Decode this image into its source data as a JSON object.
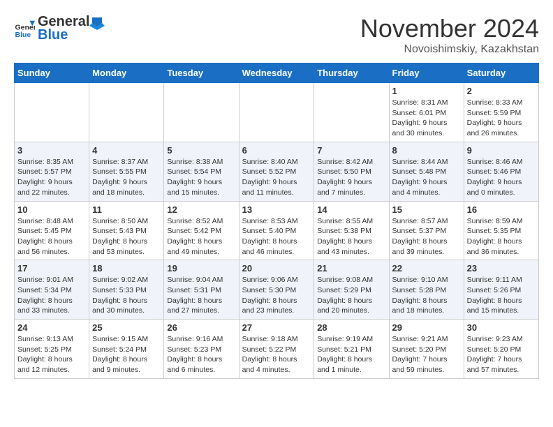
{
  "header": {
    "logo_general": "General",
    "logo_blue": "Blue",
    "month_title": "November 2024",
    "location": "Novoishimskiy, Kazakhstan"
  },
  "days_of_week": [
    "Sunday",
    "Monday",
    "Tuesday",
    "Wednesday",
    "Thursday",
    "Friday",
    "Saturday"
  ],
  "weeks": [
    [
      {
        "day": "",
        "info": ""
      },
      {
        "day": "",
        "info": ""
      },
      {
        "day": "",
        "info": ""
      },
      {
        "day": "",
        "info": ""
      },
      {
        "day": "",
        "info": ""
      },
      {
        "day": "1",
        "info": "Sunrise: 8:31 AM\nSunset: 6:01 PM\nDaylight: 9 hours and 30 minutes."
      },
      {
        "day": "2",
        "info": "Sunrise: 8:33 AM\nSunset: 5:59 PM\nDaylight: 9 hours and 26 minutes."
      }
    ],
    [
      {
        "day": "3",
        "info": "Sunrise: 8:35 AM\nSunset: 5:57 PM\nDaylight: 9 hours and 22 minutes."
      },
      {
        "day": "4",
        "info": "Sunrise: 8:37 AM\nSunset: 5:55 PM\nDaylight: 9 hours and 18 minutes."
      },
      {
        "day": "5",
        "info": "Sunrise: 8:38 AM\nSunset: 5:54 PM\nDaylight: 9 hours and 15 minutes."
      },
      {
        "day": "6",
        "info": "Sunrise: 8:40 AM\nSunset: 5:52 PM\nDaylight: 9 hours and 11 minutes."
      },
      {
        "day": "7",
        "info": "Sunrise: 8:42 AM\nSunset: 5:50 PM\nDaylight: 9 hours and 7 minutes."
      },
      {
        "day": "8",
        "info": "Sunrise: 8:44 AM\nSunset: 5:48 PM\nDaylight: 9 hours and 4 minutes."
      },
      {
        "day": "9",
        "info": "Sunrise: 8:46 AM\nSunset: 5:46 PM\nDaylight: 9 hours and 0 minutes."
      }
    ],
    [
      {
        "day": "10",
        "info": "Sunrise: 8:48 AM\nSunset: 5:45 PM\nDaylight: 8 hours and 56 minutes."
      },
      {
        "day": "11",
        "info": "Sunrise: 8:50 AM\nSunset: 5:43 PM\nDaylight: 8 hours and 53 minutes."
      },
      {
        "day": "12",
        "info": "Sunrise: 8:52 AM\nSunset: 5:42 PM\nDaylight: 8 hours and 49 minutes."
      },
      {
        "day": "13",
        "info": "Sunrise: 8:53 AM\nSunset: 5:40 PM\nDaylight: 8 hours and 46 minutes."
      },
      {
        "day": "14",
        "info": "Sunrise: 8:55 AM\nSunset: 5:38 PM\nDaylight: 8 hours and 43 minutes."
      },
      {
        "day": "15",
        "info": "Sunrise: 8:57 AM\nSunset: 5:37 PM\nDaylight: 8 hours and 39 minutes."
      },
      {
        "day": "16",
        "info": "Sunrise: 8:59 AM\nSunset: 5:35 PM\nDaylight: 8 hours and 36 minutes."
      }
    ],
    [
      {
        "day": "17",
        "info": "Sunrise: 9:01 AM\nSunset: 5:34 PM\nDaylight: 8 hours and 33 minutes."
      },
      {
        "day": "18",
        "info": "Sunrise: 9:02 AM\nSunset: 5:33 PM\nDaylight: 8 hours and 30 minutes."
      },
      {
        "day": "19",
        "info": "Sunrise: 9:04 AM\nSunset: 5:31 PM\nDaylight: 8 hours and 27 minutes."
      },
      {
        "day": "20",
        "info": "Sunrise: 9:06 AM\nSunset: 5:30 PM\nDaylight: 8 hours and 23 minutes."
      },
      {
        "day": "21",
        "info": "Sunrise: 9:08 AM\nSunset: 5:29 PM\nDaylight: 8 hours and 20 minutes."
      },
      {
        "day": "22",
        "info": "Sunrise: 9:10 AM\nSunset: 5:28 PM\nDaylight: 8 hours and 18 minutes."
      },
      {
        "day": "23",
        "info": "Sunrise: 9:11 AM\nSunset: 5:26 PM\nDaylight: 8 hours and 15 minutes."
      }
    ],
    [
      {
        "day": "24",
        "info": "Sunrise: 9:13 AM\nSunset: 5:25 PM\nDaylight: 8 hours and 12 minutes."
      },
      {
        "day": "25",
        "info": "Sunrise: 9:15 AM\nSunset: 5:24 PM\nDaylight: 8 hours and 9 minutes."
      },
      {
        "day": "26",
        "info": "Sunrise: 9:16 AM\nSunset: 5:23 PM\nDaylight: 8 hours and 6 minutes."
      },
      {
        "day": "27",
        "info": "Sunrise: 9:18 AM\nSunset: 5:22 PM\nDaylight: 8 hours and 4 minutes."
      },
      {
        "day": "28",
        "info": "Sunrise: 9:19 AM\nSunset: 5:21 PM\nDaylight: 8 hours and 1 minute."
      },
      {
        "day": "29",
        "info": "Sunrise: 9:21 AM\nSunset: 5:20 PM\nDaylight: 7 hours and 59 minutes."
      },
      {
        "day": "30",
        "info": "Sunrise: 9:23 AM\nSunset: 5:20 PM\nDaylight: 7 hours and 57 minutes."
      }
    ]
  ]
}
